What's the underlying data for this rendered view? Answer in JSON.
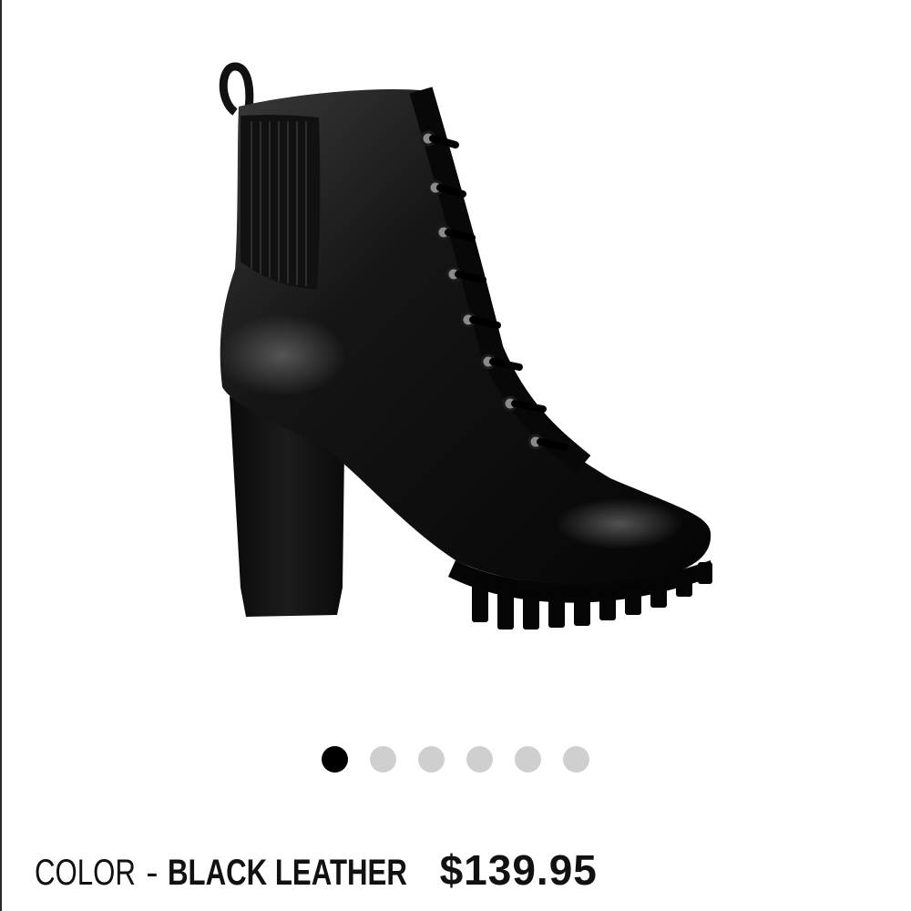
{
  "product": {
    "color_label": "COLOR",
    "color_separator": "-",
    "color_value": "BLACK LEATHER",
    "price": "$139.95",
    "image": {
      "alt_icon": "black-lace-up-heeled-boot-image"
    }
  },
  "carousel": {
    "total": 6,
    "active_index": 0,
    "colors": {
      "active": "#000000",
      "inactive": "#cfcfcf"
    }
  }
}
